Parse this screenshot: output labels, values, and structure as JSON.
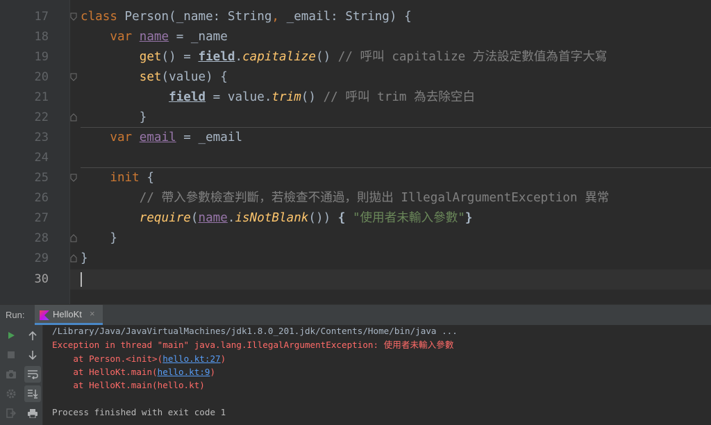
{
  "editor": {
    "line_numbers": [
      "17",
      "18",
      "19",
      "20",
      "21",
      "22",
      "23",
      "24",
      "25",
      "26",
      "27",
      "28",
      "29",
      "30"
    ],
    "active_line": "30",
    "lines": {
      "l17": {
        "kw": "class",
        "t1": " Person(_name: String",
        "comma": ",",
        "t2": " _email: String) {"
      },
      "l18": {
        "indent": "    ",
        "kw": "var",
        "sp": " ",
        "prop": "name",
        "t1": " = _name"
      },
      "l19": {
        "indent": "        ",
        "get": "get",
        "t1": "() = ",
        "field": "field",
        "dot": ".",
        "fn": "capitalize",
        "t2": "() ",
        "comment": "// 呼叫 capitalize 方法設定數值為首字大寫"
      },
      "l20": {
        "indent": "        ",
        "set": "set",
        "t1": "(value) {"
      },
      "l21": {
        "indent": "            ",
        "field": "field",
        "t1": " = value.",
        "fn": "trim",
        "t2": "() ",
        "comment": "// 呼叫 trim 為去除空白"
      },
      "l22": {
        "indent": "        ",
        "t1": "}"
      },
      "l23": {
        "indent": "    ",
        "kw": "var",
        "sp": " ",
        "prop": "email",
        "t1": " = _email"
      },
      "l25": {
        "indent": "    ",
        "kw": "init",
        "t1": " {"
      },
      "l26": {
        "indent": "        ",
        "comment": "// 帶入參數檢查判斷，若檢查不通過，則拋出 IllegalArgumentException 異常"
      },
      "l27": {
        "indent": "        ",
        "fn": "require",
        "t1": "(",
        "name": "name",
        "dot": ".",
        "fn2": "isNotBlank",
        "t2": "()) ",
        "b1": "{",
        "sp": " ",
        "str": "\"使用者未輸入參數\"",
        "b2": "}"
      },
      "l28": {
        "indent": "    ",
        "t1": "}"
      },
      "l29": {
        "t1": "}"
      }
    }
  },
  "run_panel": {
    "label": "Run:",
    "tab_label": "HelloKt",
    "tab_close": "×",
    "console": {
      "command": "/Library/Java/JavaVirtualMachines/jdk1.8.0_201.jdk/Contents/Home/bin/java ...",
      "exception": "Exception in thread \"main\" java.lang.IllegalArgumentException: 使用者未輸入參數",
      "trace1_pre": "    at Person.<init>(",
      "trace1_link": "hello.kt:27",
      "trace1_post": ")",
      "trace2_pre": "    at HelloKt.main(",
      "trace2_link": "hello.kt:9",
      "trace2_post": ")",
      "trace3": "    at HelloKt.main(hello.kt)",
      "finished": "Process finished with exit code 1"
    },
    "colors": {
      "accent": "#4a88c7",
      "run_green": "#499c54",
      "error": "#ff6b68",
      "link": "#589df6"
    }
  }
}
